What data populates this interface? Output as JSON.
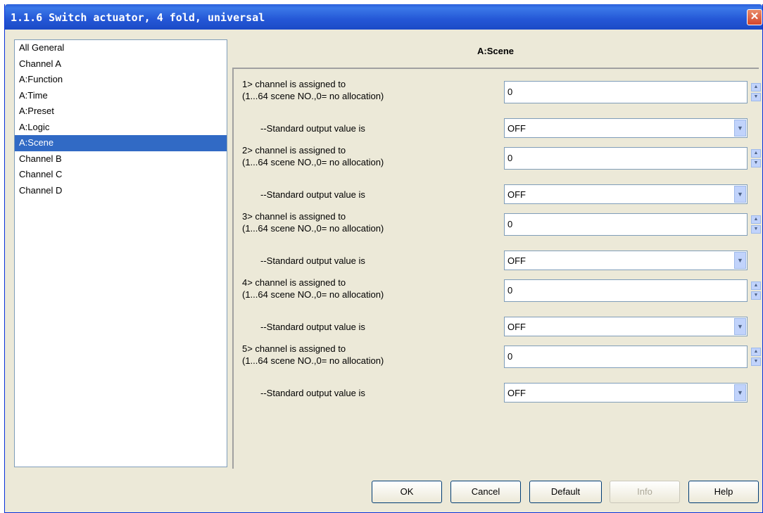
{
  "window": {
    "title": "1.1.6 Switch actuator, 4 fold, universal",
    "close_glyph": "✕"
  },
  "nav": {
    "items": [
      {
        "label": "All General"
      },
      {
        "label": "Channel A"
      },
      {
        "label": "A:Function"
      },
      {
        "label": "A:Time"
      },
      {
        "label": "A:Preset"
      },
      {
        "label": "A:Logic"
      },
      {
        "label": "A:Scene",
        "selected": true
      },
      {
        "label": "Channel B"
      },
      {
        "label": "Channel C"
      },
      {
        "label": "Channel D"
      }
    ]
  },
  "panel": {
    "title": "A:Scene",
    "params": [
      {
        "assign_line1": "1> channel is assigned to",
        "assign_line2": " (1...64 scene NO.,0= no allocation)",
        "assign_value": "0",
        "output_label": "--Standard output value is",
        "output_value": "OFF"
      },
      {
        "assign_line1": "2> channel is assigned to",
        "assign_line2": " (1...64 scene NO.,0= no allocation)",
        "assign_value": "0",
        "output_label": "--Standard output value is",
        "output_value": "OFF"
      },
      {
        "assign_line1": "3> channel is assigned to",
        "assign_line2": " (1...64 scene NO.,0= no allocation)",
        "assign_value": "0",
        "output_label": "--Standard output value is",
        "output_value": "OFF"
      },
      {
        "assign_line1": "4> channel is assigned to",
        "assign_line2": " (1...64 scene NO.,0= no allocation)",
        "assign_value": "0",
        "output_label": "--Standard output value is",
        "output_value": "OFF"
      },
      {
        "assign_line1": "5> channel is assigned to",
        "assign_line2": " (1...64 scene NO.,0= no allocation)",
        "assign_value": "0",
        "output_label": "--Standard output value is",
        "output_value": "OFF"
      }
    ]
  },
  "buttons": {
    "ok": "OK",
    "cancel": "Cancel",
    "default": "Default",
    "info": "Info",
    "help": "Help"
  },
  "icons": {
    "spin_up": "▲",
    "spin_down": "▼",
    "dropdown": "▼"
  }
}
